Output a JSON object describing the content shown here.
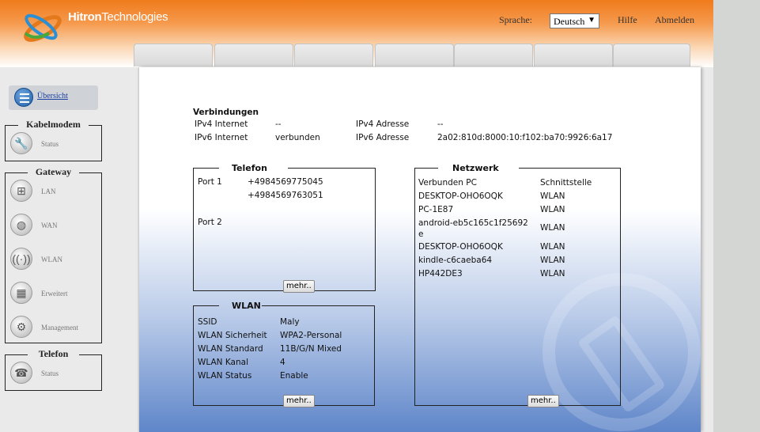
{
  "header": {
    "brand_bold": "Hitron",
    "brand_light": "Technologies",
    "language_label": "Sprache:",
    "language_value": "Deutsch",
    "help": "Hilfe",
    "logout": "Abmelden"
  },
  "sidebar": {
    "overview": "Übersicht",
    "groups": [
      {
        "title": "Kabelmodem",
        "items": [
          {
            "label": "Status",
            "icon": "wrench-icon"
          }
        ]
      },
      {
        "title": "Gateway",
        "items": [
          {
            "label": "LAN",
            "icon": "lan-icon"
          },
          {
            "label": "WAN",
            "icon": "globe-icon"
          },
          {
            "label": "WLAN",
            "icon": "wifi-icon"
          },
          {
            "label": "Erweitert",
            "icon": "firewall-icon"
          },
          {
            "label": "Management",
            "icon": "gear-icon"
          }
        ]
      },
      {
        "title": "Telefon",
        "items": [
          {
            "label": "Status",
            "icon": "phone-icon"
          }
        ]
      }
    ]
  },
  "connections": {
    "title": "Verbindungen",
    "ipv4_label": "IPv4 Internet",
    "ipv4_value": "--",
    "ipv4_addr_label": "IPv4 Adresse",
    "ipv4_addr_value": "--",
    "ipv6_label": "IPv6 Internet",
    "ipv6_value": "verbunden",
    "ipv6_addr_label": "IPv6 Adresse",
    "ipv6_addr_value": "2a02:810d:8000:10:f102:ba70:9926:6a17"
  },
  "telefon": {
    "title": "Telefon",
    "port1_label": "Port 1",
    "port1_numbers": [
      "+4984569775045",
      "+4984569763051"
    ],
    "port2_label": "Port 2",
    "more": "mehr.."
  },
  "wlan": {
    "title": "WLAN",
    "rows": [
      {
        "label": "SSID",
        "value": "Maly"
      },
      {
        "label": "WLAN Sicherheit",
        "value": "WPA2-Personal"
      },
      {
        "label": "WLAN Standard",
        "value": "11B/G/N Mixed"
      },
      {
        "label": "WLAN Kanal",
        "value": "4"
      },
      {
        "label": "WLAN Status",
        "value": "Enable"
      }
    ],
    "more": "mehr.."
  },
  "netzwerk": {
    "title": "Netzwerk",
    "col_pc": "Verbunden PC",
    "col_if": "Schnittstelle",
    "rows": [
      {
        "pc": "DESKTOP-OHO6OQK",
        "if": "WLAN"
      },
      {
        "pc": "PC-1E87",
        "if": "WLAN"
      },
      {
        "pc": "android-eb5c165c1f25692",
        "pc2": "e",
        "if": "WLAN"
      },
      {
        "pc": "DESKTOP-OHO6OQK",
        "if": "WLAN"
      },
      {
        "pc": "kindle-c6caeba64",
        "if": "WLAN"
      },
      {
        "pc": "HP442DE3",
        "if": "WLAN"
      }
    ],
    "more": "mehr.."
  }
}
